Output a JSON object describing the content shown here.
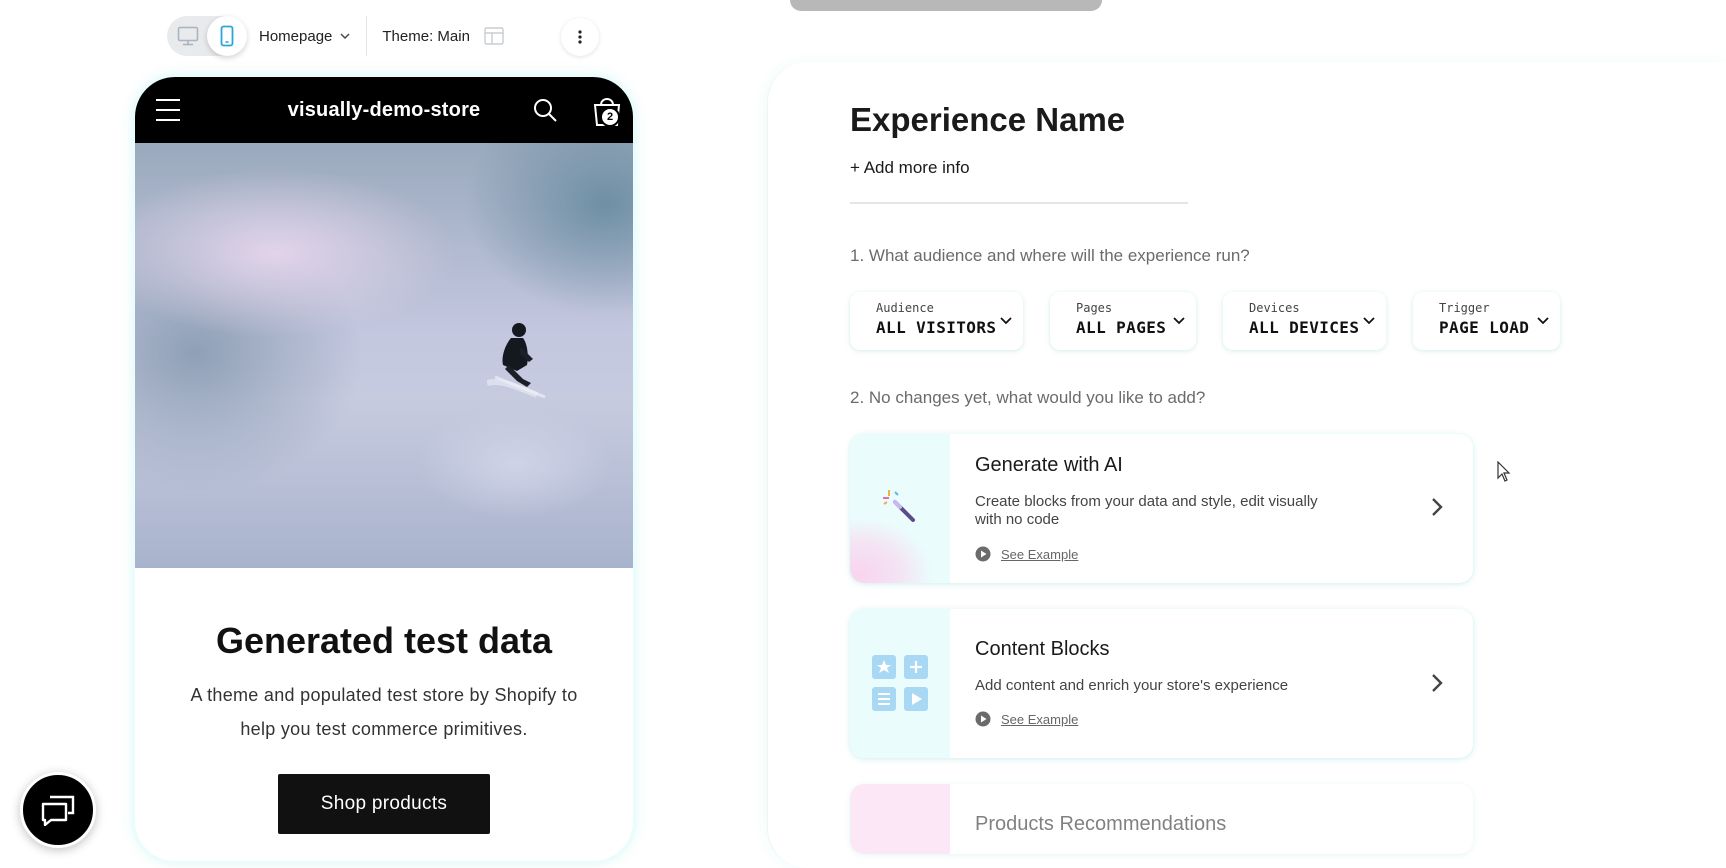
{
  "toolbar": {
    "page_select": "Homepage",
    "theme_label": "Theme: Main"
  },
  "store": {
    "name": "visually-demo-store",
    "cart_count": "2",
    "hero_title": "Generated test data",
    "hero_subtitle": "A theme and populated test store by Shopify to help you test commerce primitives.",
    "shop_button": "Shop products"
  },
  "panel": {
    "title": "Experience Name",
    "add_info": "+ Add more info",
    "question_1": "1. What audience and where will the experience run?",
    "question_2": "2. No changes yet, what would you like to add?",
    "filters": [
      {
        "label": "Audience",
        "value": "ALL VISITORS"
      },
      {
        "label": "Pages",
        "value": "ALL PAGES"
      },
      {
        "label": "Devices",
        "value": "ALL DEVICES"
      },
      {
        "label": "Trigger",
        "value": "PAGE LOAD"
      }
    ],
    "cards": [
      {
        "title": "Generate with AI",
        "desc": "Create blocks from your data and style, edit visually with no code",
        "link": "See Example"
      },
      {
        "title": "Content Blocks",
        "desc": "Add content and enrich your store's experience",
        "link": "See Example"
      },
      {
        "title": "Products Recommendations"
      }
    ]
  },
  "colors": {
    "accent": "#2aa7d8",
    "panel_border": "#bff3f3",
    "thumb_teal": "#ebfcfc",
    "thumb_pink": "#f9d4ef"
  }
}
